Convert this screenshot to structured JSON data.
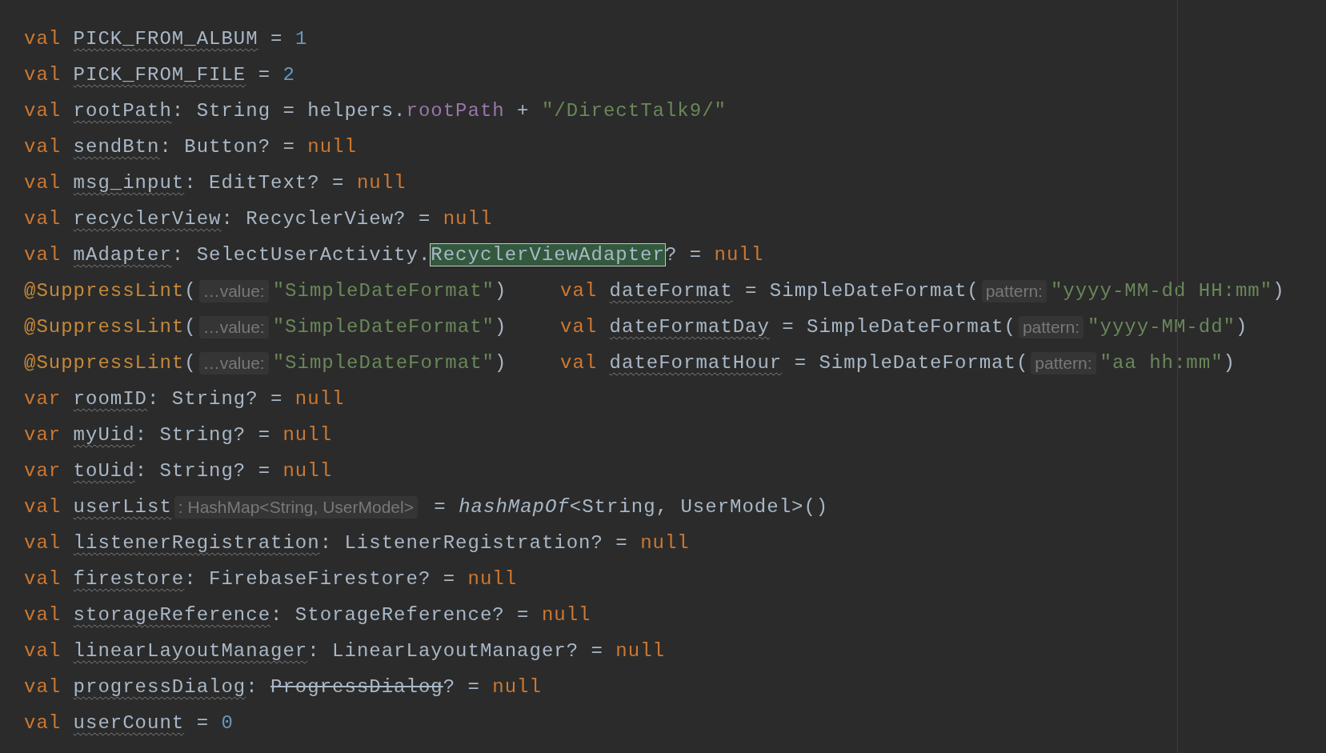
{
  "editor": {
    "lines": [
      {
        "tokens": [
          {
            "t": "val ",
            "kind": "kw"
          },
          {
            "t": "PICK_FROM_ALBUM",
            "kind": "field"
          },
          {
            "t": " = ",
            "kind": "plain"
          },
          {
            "t": "1",
            "kind": "num"
          }
        ]
      },
      {
        "tokens": [
          {
            "t": "val ",
            "kind": "kw"
          },
          {
            "t": "PICK_FROM_FILE",
            "kind": "field"
          },
          {
            "t": " = ",
            "kind": "plain"
          },
          {
            "t": "2",
            "kind": "num"
          }
        ]
      },
      {
        "tokens": [
          {
            "t": "val ",
            "kind": "kw"
          },
          {
            "t": "rootPath",
            "kind": "field"
          },
          {
            "t": ": String = helpers.",
            "kind": "plain"
          },
          {
            "t": "rootPath",
            "kind": "prop"
          },
          {
            "t": " + ",
            "kind": "plain"
          },
          {
            "t": "\"/DirectTalk9/\"",
            "kind": "str"
          }
        ]
      },
      {
        "tokens": [
          {
            "t": "val ",
            "kind": "kw"
          },
          {
            "t": "sendBtn",
            "kind": "field"
          },
          {
            "t": ": Button? = ",
            "kind": "plain"
          },
          {
            "t": "null",
            "kind": "kw"
          }
        ]
      },
      {
        "tokens": [
          {
            "t": "val ",
            "kind": "kw"
          },
          {
            "t": "msg_input",
            "kind": "field"
          },
          {
            "t": ": EditText? = ",
            "kind": "plain"
          },
          {
            "t": "null",
            "kind": "kw"
          }
        ]
      },
      {
        "tokens": [
          {
            "t": "val ",
            "kind": "kw"
          },
          {
            "t": "recyclerView",
            "kind": "field"
          },
          {
            "t": ": RecyclerView? = ",
            "kind": "plain"
          },
          {
            "t": "null",
            "kind": "kw"
          }
        ]
      },
      {
        "tokens": [
          {
            "t": "val ",
            "kind": "kw"
          },
          {
            "t": "mAdapter",
            "kind": "field"
          },
          {
            "t": ": SelectUserActivity.",
            "kind": "plain"
          },
          {
            "t": "RecyclerViewAdapter",
            "kind": "match"
          },
          {
            "t": "? = ",
            "kind": "plain"
          },
          {
            "t": "null",
            "kind": "kw"
          }
        ]
      },
      {
        "tokens": [
          {
            "t": "@SuppressLint",
            "kind": "ann"
          },
          {
            "t": "(",
            "kind": "plain"
          },
          {
            "t": "…value:",
            "kind": "hint"
          },
          {
            "t": "\"SimpleDateFormat\"",
            "kind": "str"
          },
          {
            "t": ")",
            "kind": "plain"
          }
        ],
        "tail": [
          {
            "t": "val ",
            "kind": "kw"
          },
          {
            "t": "dateFormat",
            "kind": "field"
          },
          {
            "t": " = SimpleDateFormat(",
            "kind": "plain"
          },
          {
            "t": "pattern:",
            "kind": "hint"
          },
          {
            "t": "\"yyyy-MM-dd HH:mm\"",
            "kind": "str"
          },
          {
            "t": ")",
            "kind": "plain"
          }
        ]
      },
      {
        "tokens": [
          {
            "t": "@SuppressLint",
            "kind": "ann"
          },
          {
            "t": "(",
            "kind": "plain"
          },
          {
            "t": "…value:",
            "kind": "hint"
          },
          {
            "t": "\"SimpleDateFormat\"",
            "kind": "str"
          },
          {
            "t": ")",
            "kind": "plain"
          }
        ],
        "tail": [
          {
            "t": "val ",
            "kind": "kw"
          },
          {
            "t": "dateFormatDay",
            "kind": "field"
          },
          {
            "t": " = SimpleDateFormat(",
            "kind": "plain"
          },
          {
            "t": "pattern:",
            "kind": "hint"
          },
          {
            "t": "\"yyyy-MM-dd\"",
            "kind": "str"
          },
          {
            "t": ")",
            "kind": "plain"
          }
        ]
      },
      {
        "tokens": [
          {
            "t": "@SuppressLint",
            "kind": "ann"
          },
          {
            "t": "(",
            "kind": "plain"
          },
          {
            "t": "…value:",
            "kind": "hint"
          },
          {
            "t": "\"SimpleDateFormat\"",
            "kind": "str"
          },
          {
            "t": ")",
            "kind": "plain"
          }
        ],
        "tail": [
          {
            "t": "val ",
            "kind": "kw"
          },
          {
            "t": "dateFormatHour",
            "kind": "field"
          },
          {
            "t": " = SimpleDateFormat(",
            "kind": "plain"
          },
          {
            "t": "pattern:",
            "kind": "hint"
          },
          {
            "t": "\"aa hh:mm\"",
            "kind": "str"
          },
          {
            "t": ")",
            "kind": "plain"
          }
        ]
      },
      {
        "tokens": [
          {
            "t": "var ",
            "kind": "kw"
          },
          {
            "t": "roomID",
            "kind": "field"
          },
          {
            "t": ": String? = ",
            "kind": "plain"
          },
          {
            "t": "null",
            "kind": "kw"
          }
        ]
      },
      {
        "tokens": [
          {
            "t": "var ",
            "kind": "kw"
          },
          {
            "t": "myUid",
            "kind": "field"
          },
          {
            "t": ": String? = ",
            "kind": "plain"
          },
          {
            "t": "null",
            "kind": "kw"
          }
        ]
      },
      {
        "tokens": [
          {
            "t": "var ",
            "kind": "kw"
          },
          {
            "t": "toUid",
            "kind": "field"
          },
          {
            "t": ": String? = ",
            "kind": "plain"
          },
          {
            "t": "null",
            "kind": "kw"
          }
        ]
      },
      {
        "tokens": [
          {
            "t": "val ",
            "kind": "kw"
          },
          {
            "t": "userList",
            "kind": "field"
          },
          {
            "t": ": HashMap<String, UserModel>",
            "kind": "hint"
          },
          {
            "t": " = ",
            "kind": "plain"
          },
          {
            "t": "hashMapOf",
            "kind": "fn"
          },
          {
            "t": "<String, UserModel>()",
            "kind": "plain"
          }
        ]
      },
      {
        "tokens": [
          {
            "t": "val ",
            "kind": "kw"
          },
          {
            "t": "listenerRegistration",
            "kind": "field"
          },
          {
            "t": ": ListenerRegistration? = ",
            "kind": "plain"
          },
          {
            "t": "null",
            "kind": "kw"
          }
        ]
      },
      {
        "tokens": [
          {
            "t": "val ",
            "kind": "kw"
          },
          {
            "t": "firestore",
            "kind": "field"
          },
          {
            "t": ": FirebaseFirestore? = ",
            "kind": "plain"
          },
          {
            "t": "null",
            "kind": "kw"
          }
        ]
      },
      {
        "tokens": [
          {
            "t": "val ",
            "kind": "kw"
          },
          {
            "t": "storageReference",
            "kind": "field"
          },
          {
            "t": ": StorageReference? = ",
            "kind": "plain"
          },
          {
            "t": "null",
            "kind": "kw"
          }
        ]
      },
      {
        "tokens": [
          {
            "t": "val ",
            "kind": "kw"
          },
          {
            "t": "linearLayoutManager",
            "kind": "field"
          },
          {
            "t": ": LinearLayoutManager? = ",
            "kind": "plain"
          },
          {
            "t": "null",
            "kind": "kw"
          }
        ]
      },
      {
        "tokens": [
          {
            "t": "val ",
            "kind": "kw"
          },
          {
            "t": "progressDialog",
            "kind": "field"
          },
          {
            "t": ": ",
            "kind": "plain"
          },
          {
            "t": "ProgressDialog",
            "kind": "deprecated"
          },
          {
            "t": "? = ",
            "kind": "plain"
          },
          {
            "t": "null",
            "kind": "kw"
          }
        ]
      },
      {
        "tokens": [
          {
            "t": "val ",
            "kind": "kw"
          },
          {
            "t": "userCount",
            "kind": "field"
          },
          {
            "t": " = ",
            "kind": "plain"
          },
          {
            "t": "0",
            "kind": "num"
          }
        ]
      }
    ]
  }
}
